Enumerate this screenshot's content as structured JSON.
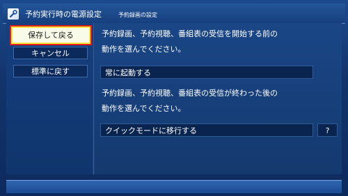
{
  "header": {
    "title": "予約実行時の電源設定",
    "subtitle": "予約録画の設定"
  },
  "sidebar": {
    "items": [
      {
        "label": "保存して戻る",
        "selected": true
      },
      {
        "label": "キャンセル",
        "selected": false
      },
      {
        "label": "標準に戻す",
        "selected": false
      }
    ]
  },
  "main": {
    "before": {
      "line1": "予約録画、予約視聴、番組表の受信を開始する前の",
      "line2": "動作を選んでください。",
      "value": "常に起動する"
    },
    "after": {
      "line1": "予約録画、予約視聴、番組表の受信が終わった後の",
      "line2": "動作を選んでください。",
      "value": "クイックモードに移行する"
    },
    "help_label": "?"
  },
  "colors": {
    "selected_fill": "#f8fbe7",
    "selected_border": "#f6e63e",
    "selected_outline": "#e11f1f"
  },
  "icons": {
    "app": "wrench-icon"
  }
}
